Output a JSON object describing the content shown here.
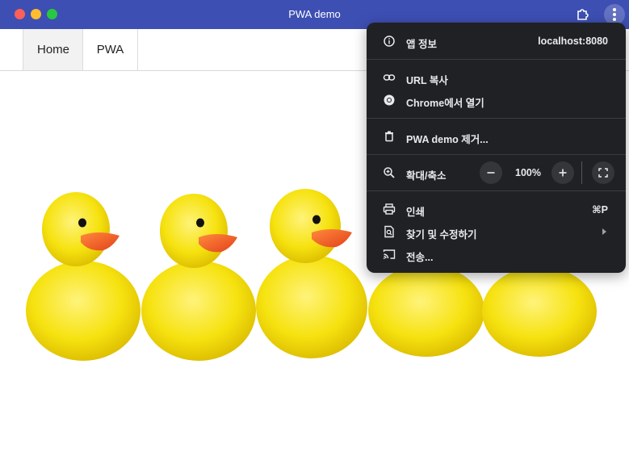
{
  "window": {
    "title": "PWA demo"
  },
  "nav": {
    "items": [
      {
        "label": "Home"
      },
      {
        "label": "PWA"
      }
    ]
  },
  "menu": {
    "app_info": {
      "label": "앱 정보",
      "value": "localhost:8080"
    },
    "copy_url": {
      "label": "URL 복사"
    },
    "open_in_chrome": {
      "label": "Chrome에서 열기"
    },
    "uninstall": {
      "label": "PWA demo 제거..."
    },
    "zoom": {
      "label": "확대/축소",
      "value": "100%"
    },
    "print": {
      "label": "인쇄",
      "shortcut": "⌘P"
    },
    "find": {
      "label": "찾기 및 수정하기"
    },
    "cast": {
      "label": "전송..."
    }
  },
  "colors": {
    "titlebar": "#3d4fb3",
    "menu_bg": "#202124",
    "duck_yellow": "#f6e20f",
    "beak_orange": "#f05a23"
  },
  "icons": [
    "info-icon",
    "link-icon",
    "chrome-icon",
    "trash-icon",
    "zoom-icon",
    "printer-icon",
    "find-icon",
    "cast-icon",
    "extension-icon",
    "kebab-icon",
    "fullscreen-icon"
  ]
}
